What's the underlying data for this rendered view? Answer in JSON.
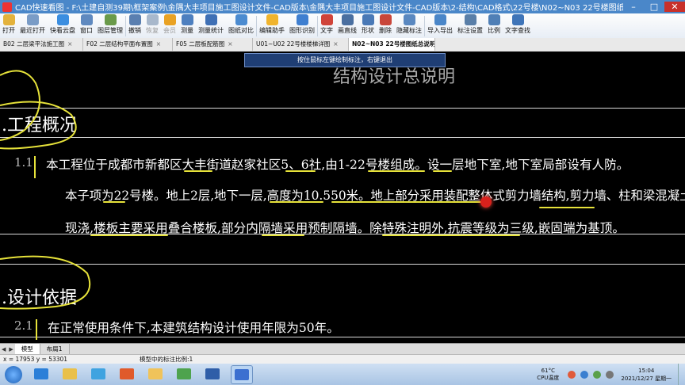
{
  "window": {
    "title": "CAD快速看图 - F:\\土建自测39期\\框架案例\\金隅大丰项目施工图设计文件-CAD版本\\金隅大丰项目施工图设计文件-CAD版本\\2-结构\\CAD格式\\22号楼\\N02~N03  22号楼图纸总说明.dwg",
    "controls": [
      "–",
      "□",
      "✕"
    ]
  },
  "toolbar": [
    {
      "label": "打开",
      "icon": "folder-icon",
      "color": "#e3b23c"
    },
    {
      "label": "最近打开",
      "icon": "recent-icon",
      "color": "#7a9cc6"
    },
    {
      "label": "快看云盘",
      "icon": "cloud-icon",
      "color": "#3b8ee0"
    },
    {
      "label": "窗口",
      "icon": "window-icon",
      "color": "#5f89bf"
    },
    {
      "label": "图层管理",
      "icon": "layers-icon",
      "color": "#6a9a4a"
    },
    {
      "label": "撤销",
      "icon": "undo-icon",
      "color": "#5a7fb0"
    },
    {
      "label": "恢复",
      "icon": "redo-icon",
      "color": "#a8b8cc",
      "disabled": true
    },
    {
      "label": "会员",
      "icon": "vip-icon",
      "color": "#e9a224",
      "disabled": true
    },
    {
      "label": "测量",
      "icon": "measure-icon",
      "color": "#4d7fbf"
    },
    {
      "label": "测量统计",
      "icon": "measure-stats-icon",
      "color": "#3f70b5"
    },
    {
      "label": "图纸对比",
      "icon": "compare-icon",
      "color": "#4b8bd0"
    },
    {
      "label": "编辑助手",
      "icon": "edit-assistant-icon",
      "color": "#f0b42e"
    },
    {
      "label": "图形识别",
      "icon": "recognize-icon",
      "color": "#3f7fd0"
    },
    {
      "label": "文字",
      "icon": "text-icon",
      "color": "#d0443a"
    },
    {
      "label": "画直线",
      "icon": "line-icon",
      "color": "#4a6fa0"
    },
    {
      "label": "形状",
      "icon": "shape-icon",
      "color": "#4a79b6"
    },
    {
      "label": "删除",
      "icon": "delete-icon",
      "color": "#c9463a"
    },
    {
      "label": "隐藏标注",
      "icon": "hide-annotation-icon",
      "color": "#5a88c0"
    },
    {
      "label": "导入导出",
      "icon": "import-export-icon",
      "color": "#4a86c8"
    },
    {
      "label": "标注设置",
      "icon": "annotation-settings-icon",
      "color": "#5a7fa8"
    },
    {
      "label": "比例",
      "icon": "scale-icon",
      "color": "#4f7fb6"
    },
    {
      "label": "文字查找",
      "icon": "text-search-icon",
      "color": "#3e74b8"
    }
  ],
  "doc_tabs": [
    {
      "label": "B02 二层梁平法施工图",
      "active": false
    },
    {
      "label": "F02 二层结构平面布置图",
      "active": false
    },
    {
      "label": "F05 二层板配筋图",
      "active": false
    },
    {
      "label": "U01~U02 22号楼楼梯详图",
      "active": false
    },
    {
      "label": "N02~N03  22号楼图纸总说明",
      "active": true
    }
  ],
  "tooltip": "按住鼠标左键绘制标注，右键退出",
  "drawing": {
    "main_title": "结构设计总说明",
    "section1_heading": "工程概况",
    "para1_num": "1.1",
    "para1_line1": "本工程位于成都市新都区大丰街道赵家社区5、6社,由1-22号楼组成。设一层地下室,地下室局部设有人防。",
    "para1_line2": "本子项为22号楼。地上2层,地下一层,高度为10.550米。地上部分采用装配整体式剪力墙结构,剪力墙、柱和梁混凝土采用",
    "para1_line3": "现浇,楼板主要采用叠合楼板,部分内隔墙采用预制隔墙。除特殊注明外,抗震等级为三级,嵌固端为基顶。",
    "section2_heading": "设计依据",
    "para2_num": "2.1",
    "para2_line1": "在正常使用条件下,本建筑结构设计使用年限为50年。",
    "annotation_color": "#e6e23a"
  },
  "layout_tabs": {
    "nav": [
      "◀",
      "▶"
    ],
    "tabs": [
      {
        "label": "模型",
        "active": true
      },
      {
        "label": "布局1",
        "active": false
      }
    ]
  },
  "status": {
    "coords": "x = 17953  y = 53301",
    "scale": "模型中的标注比例:1"
  },
  "taskbar": {
    "apps": [
      {
        "icon": "ie-icon",
        "color": "#2b7fd8"
      },
      {
        "icon": "explorer-icon",
        "color": "#e9c04a"
      },
      {
        "icon": "cloud-drive-icon",
        "color": "#3fa3e0"
      },
      {
        "icon": "media-icon",
        "color": "#e05a2b"
      },
      {
        "icon": "folder-icon",
        "color": "#f0c35a"
      },
      {
        "icon": "browser-icon",
        "color": "#4ea34e"
      },
      {
        "icon": "word-icon",
        "color": "#2f5ea8"
      },
      {
        "icon": "cad-viewer-icon",
        "color": "#3b6fd0",
        "active": true
      }
    ],
    "temp_value": "61°C",
    "temp_label": "CPU温度",
    "time": "15:04",
    "date": "2021/12/27 星期一"
  }
}
